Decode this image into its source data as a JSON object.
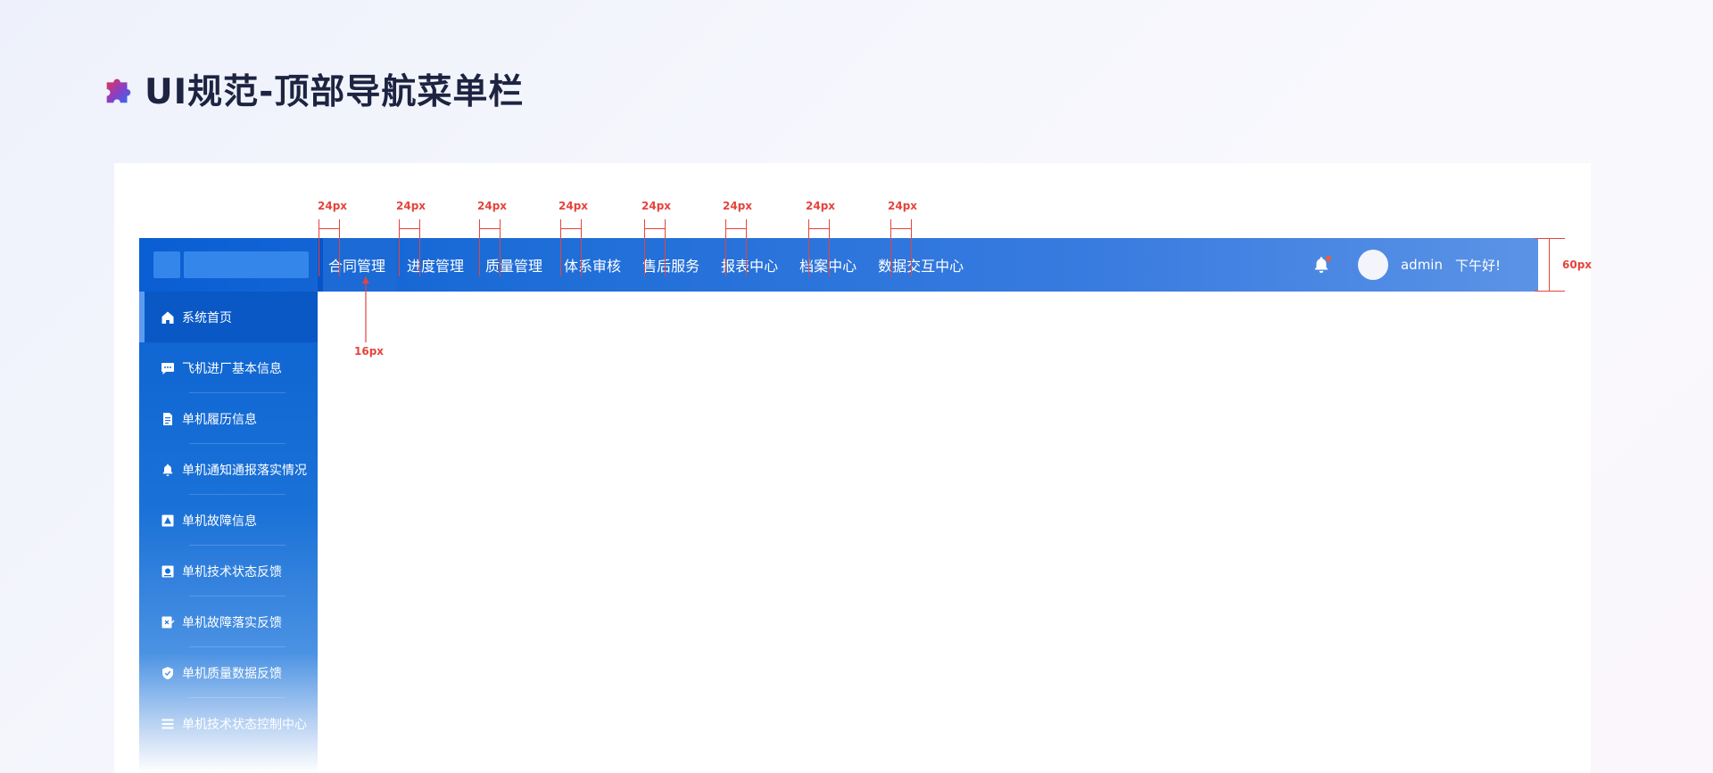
{
  "page": {
    "title": "UI规范-顶部导航菜单栏"
  },
  "topbar": {
    "nav_items": [
      {
        "label": "合同管理",
        "active": true
      },
      {
        "label": "进度管理"
      },
      {
        "label": "质量管理"
      },
      {
        "label": "体系审核"
      },
      {
        "label": "售后服务"
      },
      {
        "label": "报表中心"
      },
      {
        "label": "档案中心"
      },
      {
        "label": "数据交互中心"
      }
    ],
    "user": {
      "name": "admin",
      "greeting": "下午好!"
    }
  },
  "sidebar": {
    "items": [
      {
        "label": "系统首页",
        "icon": "home-icon",
        "active": true
      },
      {
        "label": "飞机进厂基本信息",
        "icon": "chat-icon"
      },
      {
        "label": "单机履历信息",
        "icon": "document-icon"
      },
      {
        "label": "单机通知通报落实情况",
        "icon": "bell-icon"
      },
      {
        "label": "单机故障信息",
        "icon": "warning-icon"
      },
      {
        "label": "单机技术状态反馈",
        "icon": "monitor-icon"
      },
      {
        "label": "单机故障落实反馈",
        "icon": "edit-icon"
      },
      {
        "label": "单机质量数据反馈",
        "icon": "shield-icon"
      },
      {
        "label": "单机技术状态控制中心",
        "icon": "list-icon"
      }
    ]
  },
  "annotations": {
    "spacing_labels": [
      "24px",
      "24px",
      "24px",
      "24px",
      "24px",
      "24px",
      "24px",
      "24px"
    ],
    "padding_label": "16px",
    "height_label": "60px"
  },
  "colors": {
    "accent": "#e4443c",
    "nav_start": "#0a5ed3",
    "nav_end": "#5b93e6",
    "title": "#1d2441"
  }
}
